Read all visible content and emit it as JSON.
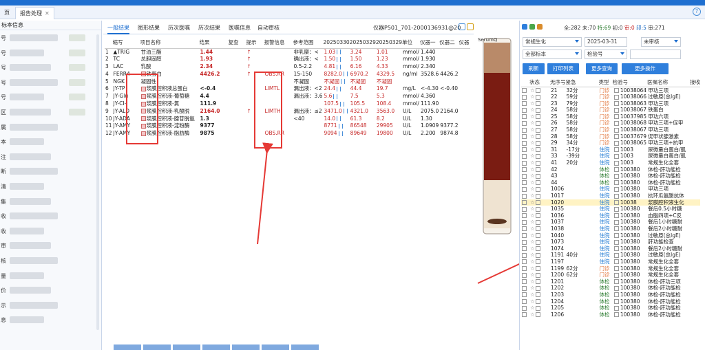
{
  "tabs": [
    {
      "label": "页",
      "active": false
    },
    {
      "label": "报告处理",
      "active": true
    }
  ],
  "left_panel": {
    "title": "标本信息",
    "field_labels": [
      "号",
      "号",
      "号",
      "号",
      "号",
      "区",
      "属",
      "本",
      "注",
      "断",
      "清",
      "集",
      "收",
      "收",
      "审",
      "核",
      "量",
      "价",
      "示",
      "息"
    ]
  },
  "result_panel": {
    "subtabs": [
      "一般结果",
      "图形结果",
      "历次医嘱",
      "历次结果",
      "医嘱信息",
      "自动审核"
    ],
    "instrument": "仪器P501_701-2000136931@20",
    "columns": [
      "",
      "缩写",
      "项目名称",
      "结果",
      "复查",
      "提示",
      "报警信息",
      "参考范围",
      "20250330",
      "20250329",
      "20250329",
      "单位",
      "仪器一",
      "仪器二",
      "仪器"
    ],
    "rows": [
      {
        "n": "1",
        "abbr": "▲TRIG",
        "name": "甘油三酯",
        "result": "1.44",
        "flag": "↑",
        "alarm": "",
        "ref": "非乳糜：<",
        "h1": "1.03",
        "h2": "3.24",
        "h3": "1.01",
        "unit": "mmol/",
        "i1": "1.440",
        "i2": "",
        "red": true
      },
      {
        "n": "2",
        "abbr": "TC",
        "name": "总胆固醇",
        "result": "1.93",
        "flag": "↑",
        "alarm": "",
        "ref": "确出液：<",
        "h1": "1.50",
        "h2": "1.50",
        "h3": "1.23",
        "unit": "mmol/",
        "i1": "1.930",
        "i2": "",
        "red": true
      },
      {
        "n": "3",
        "abbr": "LAC",
        "name": "乳酸",
        "result": "2.34",
        "flag": "↑",
        "alarm": "",
        "ref": "0.5-2.2",
        "h1": "4.81",
        "h2": "6.16",
        "h3": "4.33",
        "unit": "mmol/",
        "i1": "2.340",
        "i2": "",
        "red": true
      },
      {
        "n": "4",
        "abbr": "FERR4",
        "name": "铁蛋白",
        "result": "4426.2",
        "flag": "↑",
        "alarm": "OBS.RR",
        "ref": "15-150",
        "h1": "8282.0",
        "h2": "6970.2",
        "h3": "4329.5",
        "unit": "ng/ml",
        "i1": "3528.6",
        "i2": "4426.2",
        "red": true
      },
      {
        "n": "5",
        "abbr": "NGK",
        "name": "凝固性",
        "result": "",
        "flag": "",
        "alarm": "",
        "ref": "不凝固",
        "h1": "不凝固",
        "h2": "不凝固",
        "h3": "不凝固",
        "unit": "",
        "i1": "",
        "i2": "",
        "red": false
      },
      {
        "n": "6",
        "abbr": "JY-TP",
        "name": "浆膜腔积液总蛋白",
        "result": "<-0.4",
        "flag": "",
        "alarm": "LIMTL",
        "ref": "漏出液：<2",
        "h1": "24.4",
        "h2": "44.4",
        "h3": "19.7",
        "unit": "mg/L",
        "i1": "<-4.30",
        "i2": "<-0.40",
        "red": false
      },
      {
        "n": "7",
        "abbr": "JY-Glu",
        "name": "浆膜腔积液-葡萄糖",
        "result": "4.4",
        "flag": "",
        "alarm": "",
        "ref": "漏出液：3.6",
        "h1": "5.6",
        "h2": "7.5",
        "h3": "5.3",
        "unit": "mmol/",
        "i1": "4.360",
        "i2": "",
        "red": false
      },
      {
        "n": "8",
        "abbr": "JY-CI-",
        "name": "浆膜腔积液-氯",
        "result": "111.9",
        "flag": "",
        "alarm": "",
        "ref": "",
        "h1": "107.5",
        "h2": "105.5",
        "h3": "108.4",
        "unit": "mmol/",
        "i1": "111.90",
        "i2": "",
        "red": false
      },
      {
        "n": "9",
        "abbr": "JY-ALD",
        "name": "浆膜腔积液-乳酸脱",
        "result": "2164.0",
        "flag": "↑",
        "alarm": "LIMTH",
        "ref": "漏出液：≤2",
        "h1": "3471.0",
        "h2": "4321.0",
        "h3": "3563.0",
        "unit": "U/L",
        "i1": "2075.0",
        "i2": "2164.0",
        "red": true
      },
      {
        "n": "10",
        "abbr": "JY-ADA",
        "name": "浆膜腔积液-腺苷脱氨",
        "result": "1.3",
        "flag": "",
        "alarm": "",
        "ref": "<40",
        "h1": "14.0",
        "h2": "61.3",
        "h3": "8.2",
        "unit": "U/L",
        "i1": "1.30",
        "i2": "",
        "red": false
      },
      {
        "n": "11",
        "abbr": "JY-AMY",
        "name": "浆膜腔积液-淀粉酶",
        "result": "9377",
        "flag": "",
        "alarm": "",
        "ref": "",
        "h1": "8771",
        "h2": "86548",
        "h3": "29905",
        "unit": "U/L",
        "i1": "1.0909",
        "i2": "9377.2",
        "red": false
      },
      {
        "n": "12",
        "abbr": "JY-AMY",
        "name": "浆膜腔积液-脂肪酶",
        "result": "9875",
        "flag": "",
        "alarm": "OBS.RR",
        "ref": "",
        "h1": "9094",
        "h2": "89649",
        "h3": "19800",
        "unit": "U/L",
        "i1": "2.200",
        "i2": "9874.8",
        "red": false
      }
    ]
  },
  "tube_label": "SerumQ",
  "right_panel": {
    "status": {
      "total": "全:282",
      "not": "未:70",
      "pending": "特:69",
      "initial": "初:0",
      "reviewed": "审:0",
      "print": "印:5",
      "pass": "审:271"
    },
    "category_select": "常规生化",
    "date": "2025-03-31",
    "review_select": "未审核",
    "all_select": "全部标本",
    "sample_no_select": "检验号",
    "buttons": [
      "刷新",
      "打印列表",
      "更多查询",
      "更多操作"
    ],
    "columns": [
      "",
      "状态",
      "无序号",
      "紧急",
      "类型",
      "检验号",
      "医嘱名称",
      "接收"
    ],
    "rows": [
      {
        "seq": "21",
        "t": "32分",
        "type": "门诊",
        "no": "10038064",
        "name": "甲功三项",
        "hl": false
      },
      {
        "seq": "22",
        "t": "59分",
        "type": "门诊",
        "no": "10038066",
        "name": "过敏原(总IgE)",
        "hl": false
      },
      {
        "seq": "23",
        "t": "79分",
        "type": "门诊",
        "no": "10038063",
        "name": "甲功三项",
        "hl": false
      },
      {
        "seq": "24",
        "t": "58分",
        "type": "门诊",
        "no": "10038067",
        "name": "铁蛋白",
        "hl": false
      },
      {
        "seq": "25",
        "t": "58分",
        "type": "门诊",
        "no": "10037985",
        "name": "甲功六项",
        "hl": false
      },
      {
        "seq": "26",
        "t": "58分",
        "type": "门诊",
        "no": "10038068",
        "name": "甲功三项+促甲",
        "hl": false
      },
      {
        "seq": "27",
        "t": "58分",
        "type": "门诊",
        "no": "10038067",
        "name": "甲功三项",
        "hl": false
      },
      {
        "seq": "28",
        "t": "58分",
        "type": "门诊",
        "no": "10037679",
        "name": "促甲状腺激素",
        "hl": false
      },
      {
        "seq": "29",
        "t": "34分",
        "type": "门诊",
        "no": "10038065",
        "name": "甲功三项+抗甲",
        "hl": false
      },
      {
        "seq": "31",
        "t": "-17分",
        "type": "住院",
        "no": "1003",
        "name": "尿微量白蛋白/肌",
        "hl": false
      },
      {
        "seq": "33",
        "t": "-39分",
        "type": "住院",
        "no": "1003",
        "name": "尿微量白蛋白/肌",
        "hl": false
      },
      {
        "seq": "41",
        "t": "20分",
        "type": "住院",
        "no": "1003",
        "name": "常规生化全套",
        "hl": false
      },
      {
        "seq": "42",
        "t": "",
        "type": "体检",
        "no": "100380",
        "name": "体检-肝功能检",
        "hl": false
      },
      {
        "seq": "43",
        "t": "",
        "type": "体检",
        "no": "100380",
        "name": "体检-肝功能检",
        "hl": false
      },
      {
        "seq": "44",
        "t": "",
        "type": "体检",
        "no": "100380",
        "name": "体检-肝功能检",
        "hl": false
      },
      {
        "seq": "1006",
        "t": "",
        "type": "住院",
        "no": "100380",
        "name": "甲功三项",
        "hl": false
      },
      {
        "seq": "1017",
        "t": "",
        "type": "住院",
        "no": "100380",
        "name": "抗环瓜氨酸抗体",
        "hl": false
      },
      {
        "seq": "1020",
        "t": "",
        "type": "住院",
        "no": "10038",
        "name": "浆膜腔积液生化",
        "hl": true
      },
      {
        "seq": "1035",
        "t": "",
        "type": "住院",
        "no": "100380",
        "name": "餐后0.5小时糖",
        "hl": false
      },
      {
        "seq": "1036",
        "t": "",
        "type": "住院",
        "no": "100380",
        "name": "血脂四项+C反",
        "hl": false
      },
      {
        "seq": "1037",
        "t": "",
        "type": "住院",
        "no": "100380",
        "name": "餐后1小时糖耐",
        "hl": false
      },
      {
        "seq": "1038",
        "t": "",
        "type": "住院",
        "no": "100380",
        "name": "餐后2小时糖耐",
        "hl": false
      },
      {
        "seq": "1040",
        "t": "",
        "type": "住院",
        "no": "100380",
        "name": "过敏原(总IgE)",
        "hl": false
      },
      {
        "seq": "1073",
        "t": "",
        "type": "住院",
        "no": "100380",
        "name": "肝功能检查",
        "hl": false
      },
      {
        "seq": "1074",
        "t": "",
        "type": "住院",
        "no": "100380",
        "name": "餐后2小时糖耐",
        "hl": false
      },
      {
        "seq": "1191",
        "t": "40分",
        "type": "住院",
        "no": "100380",
        "name": "过敏原(总IgE)",
        "hl": false
      },
      {
        "seq": "1197",
        "t": "",
        "type": "住院",
        "no": "100380",
        "name": "常规生化全套",
        "hl": false
      },
      {
        "seq": "1199",
        "t": "62分",
        "type": "门诊",
        "no": "100380",
        "name": "常规生化全套",
        "hl": false
      },
      {
        "seq": "1200",
        "t": "62分",
        "type": "门诊",
        "no": "100380",
        "name": "常规生化全套",
        "hl": false
      },
      {
        "seq": "1201",
        "t": "",
        "type": "体检",
        "no": "100380",
        "name": "体检-肝功三项",
        "hl": false
      },
      {
        "seq": "1202",
        "t": "",
        "type": "体检",
        "no": "100380",
        "name": "体检-肝功能检",
        "hl": false
      },
      {
        "seq": "1203",
        "t": "",
        "type": "体检",
        "no": "100380",
        "name": "体检-肝功能检",
        "hl": false
      },
      {
        "seq": "1204",
        "t": "",
        "type": "体检",
        "no": "100380",
        "name": "体检-肝功能检",
        "hl": false
      },
      {
        "seq": "1205",
        "t": "",
        "type": "体检",
        "no": "100380",
        "name": "体检-肝功能检",
        "hl": false
      },
      {
        "seq": "1206",
        "t": "",
        "type": "体检",
        "no": "100380",
        "name": "体检-肝功能检",
        "hl": false
      }
    ]
  },
  "colors": {
    "accent": "#1e6fd0",
    "alert": "#e53935",
    "highlight": "#fff3c4"
  }
}
